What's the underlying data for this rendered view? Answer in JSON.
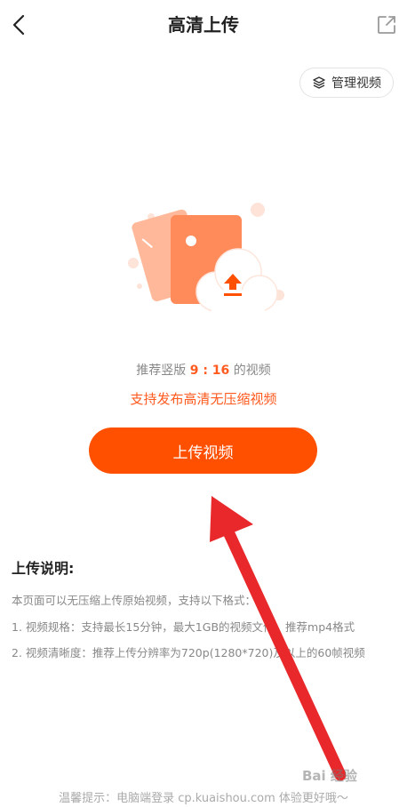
{
  "header": {
    "title": "高清上传",
    "back_icon": "chevron-left-icon",
    "share_icon": "external-link-icon"
  },
  "manage_button": {
    "label": "管理视频",
    "icon": "layers-icon"
  },
  "hint": {
    "prefix": "推荐竖版 ",
    "ratio": "9 : 16",
    "suffix": " 的视频"
  },
  "support_text": "支持发布高清无压缩视频",
  "upload_button": {
    "label": "上传视频"
  },
  "instructions": {
    "title": "上传说明:",
    "lines": [
      "本页面可以无压缩上传原始视频，支持以下格式：",
      "1. 视频规格：支持最长15分钟，最大1GB的视频文件，推荐mp4格式",
      "2. 视频清晰度：推荐上传分辨率为720p(1280*720)及以上的60帧视频"
    ]
  },
  "footer": "温馨提示：电脑端登录 cp.kuaishou.com 体验更好哦～",
  "watermark": "Bai 经验",
  "colors": {
    "accent": "#ff5000",
    "accent_text": "#ff5a1f",
    "annotation_arrow": "#e8282b"
  }
}
